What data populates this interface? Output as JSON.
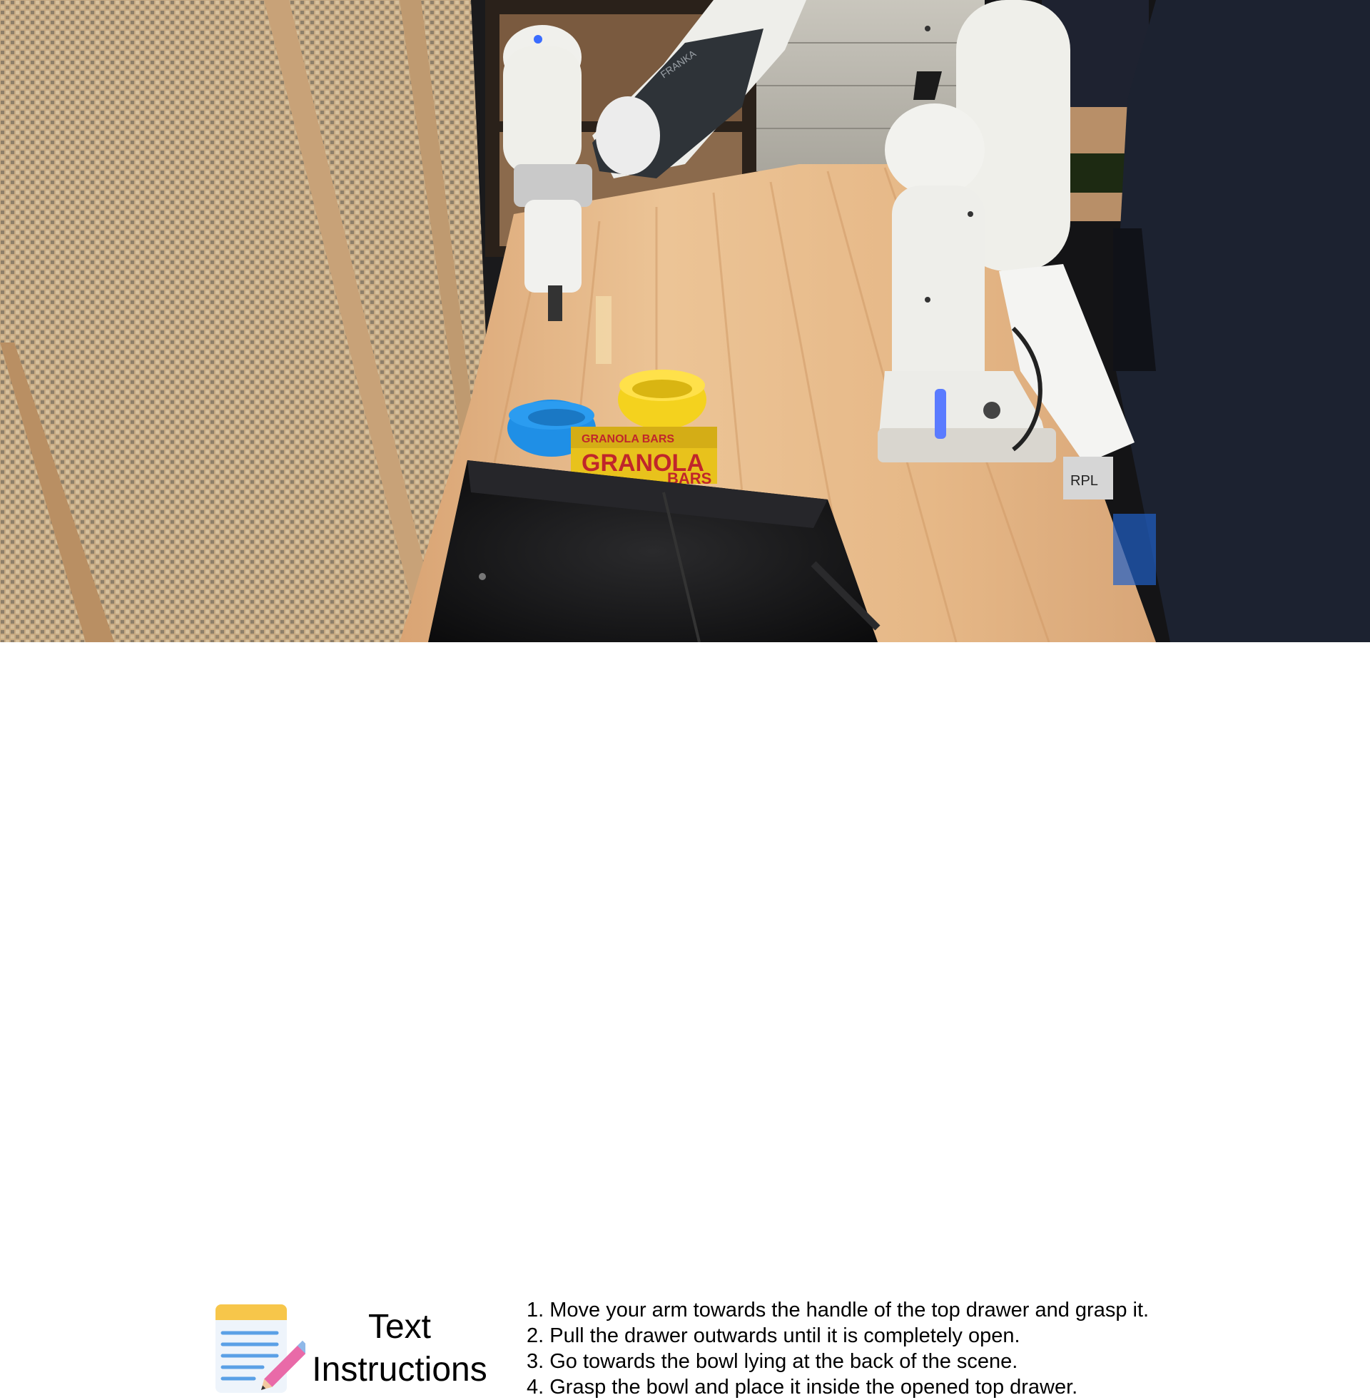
{
  "scene": {
    "box_label_top": "GRANOLA BARS",
    "box_label_main": "GRANOLA",
    "box_label_sub": "BARS",
    "sticker_label": "RPL",
    "robot_brand": "FRANKA",
    "colors": {
      "bowl_blue": "#1f8fe6",
      "bowl_yellow": "#f4d21e",
      "box_yellow": "#e8c21c",
      "box_red": "#c0262b",
      "table_wood": "#e8b98a",
      "robot_white": "#eeeeea",
      "bag_black": "#0c0c0e",
      "status_led": "#5a7bff"
    }
  },
  "panel": {
    "icon": "notepad-pencil-icon",
    "title_line1": "Text",
    "title_line2": "Instructions",
    "steps": [
      "1. Move your arm towards the handle of the top drawer and grasp it.",
      "2. Pull the drawer outwards until it is completely open.",
      "3. Go towards the bowl lying at the back of the scene.",
      "4. Grasp the bowl and place it inside the opened top drawer."
    ]
  }
}
